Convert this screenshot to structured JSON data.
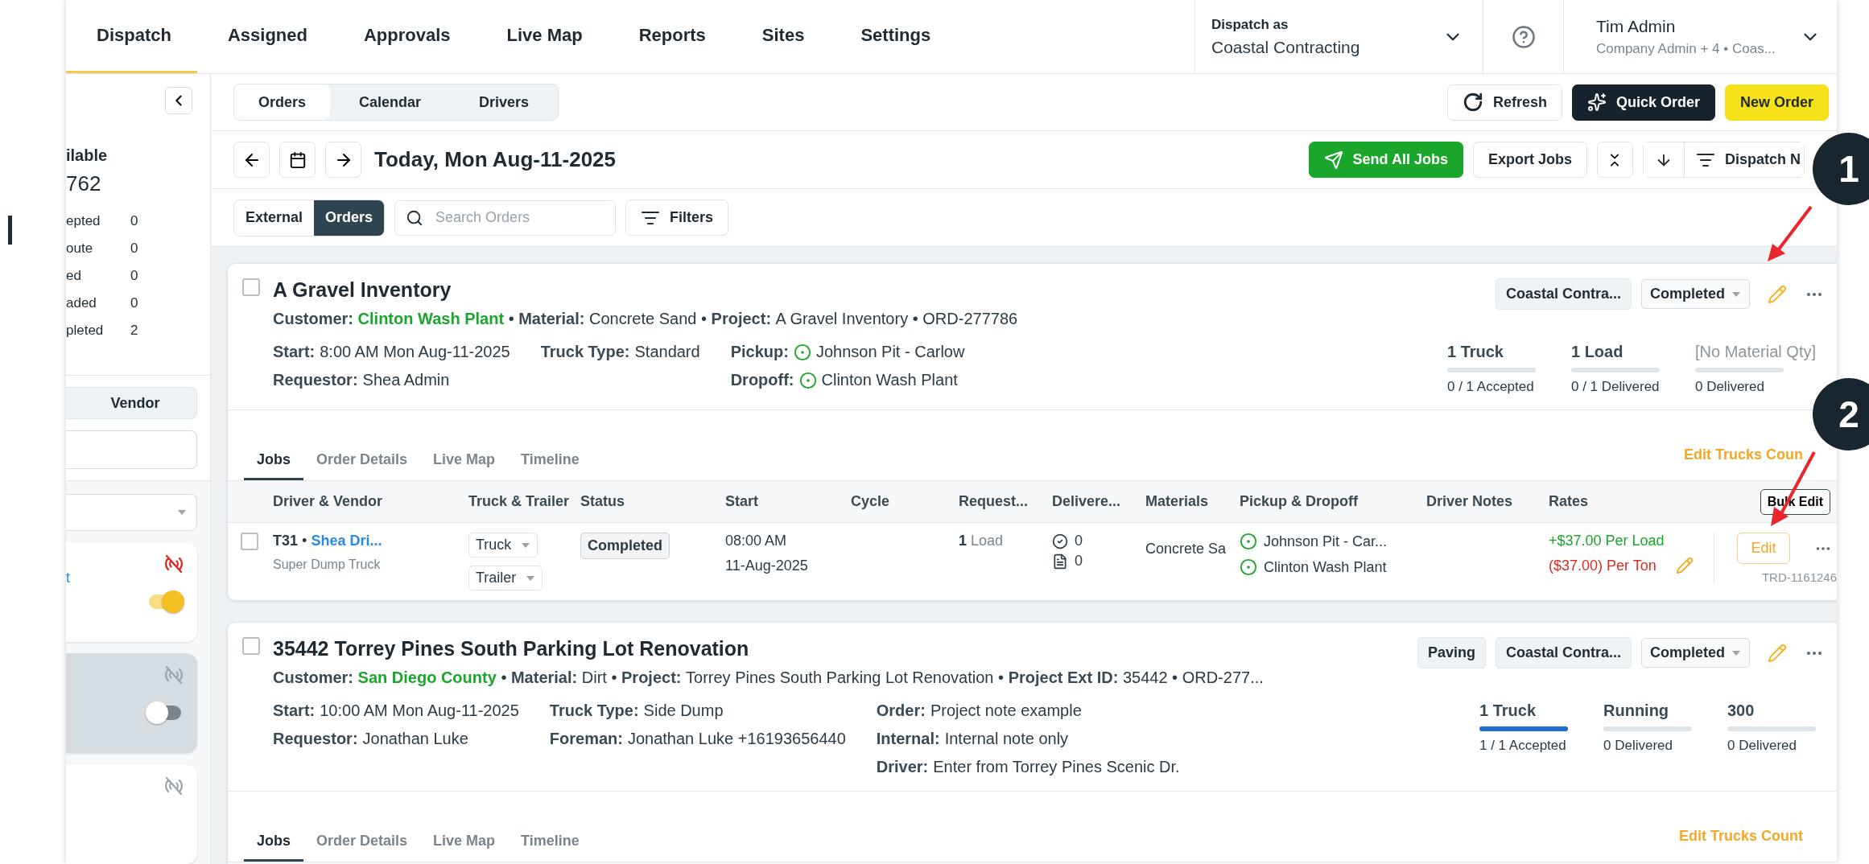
{
  "nav": {
    "tabs": [
      {
        "label": "Dispatch",
        "selected": true
      },
      {
        "label": "Assigned",
        "selected": false
      },
      {
        "label": "Approvals",
        "selected": false
      },
      {
        "label": "Live Map",
        "selected": false
      },
      {
        "label": "Reports",
        "selected": false
      },
      {
        "label": "Sites",
        "selected": false
      },
      {
        "label": "Settings",
        "selected": false
      }
    ],
    "dispatch_as": {
      "label": "Dispatch as",
      "value": "Coastal Contracting"
    },
    "user": {
      "name": "Tim Admin",
      "role": "Company Admin + 4 • Coas..."
    }
  },
  "sidebar": {
    "stats_title": "ilable",
    "stats_total": "762",
    "stats": [
      {
        "label": "epted",
        "value": "0"
      },
      {
        "label": "oute",
        "value": "0"
      },
      {
        "label": "ed",
        "value": "0"
      },
      {
        "label": "aded",
        "value": "0"
      },
      {
        "label": "pleted",
        "value": "2"
      }
    ],
    "segment": "Vendor",
    "drivers": [
      {
        "name": "t",
        "signal_lost": true,
        "on": true,
        "selected": false
      },
      {
        "signal_lost": false,
        "on": false,
        "selected": true
      },
      {
        "signal_lost": false,
        "selected": false
      }
    ]
  },
  "view_tabs": [
    {
      "label": "Orders",
      "selected": true
    },
    {
      "label": "Calendar",
      "selected": false
    },
    {
      "label": "Drivers",
      "selected": false
    }
  ],
  "actions": [
    {
      "kind": "refresh",
      "label": "Refresh"
    },
    {
      "kind": "quick",
      "label": "Quick Order"
    },
    {
      "kind": "new",
      "label": "New Order"
    }
  ],
  "date": "Today, Mon Aug-11-2025",
  "toolbar": {
    "send": "Send All Jobs",
    "export": "Export Jobs",
    "sort": "Dispatch N"
  },
  "source_tabs": [
    {
      "label": "External",
      "selected": false
    },
    {
      "label": "Orders",
      "selected": true
    }
  ],
  "search": {
    "placeholder": "Search Orders"
  },
  "filters": "Filters",
  "orders": [
    {
      "title": "A Gravel Inventory",
      "checked": false,
      "separator": "•",
      "tags": [
        "Coastal Contra..."
      ],
      "status": "Completed",
      "meta": [
        {
          "label": "Customer:",
          "value": "Clinton Wash Plant",
          "kind": "link"
        },
        {
          "label": "Material:",
          "value": "Concrete Sand"
        },
        {
          "label": "Project:",
          "value": "A Gravel Inventory"
        },
        {
          "value": "ORD-277786"
        }
      ],
      "details": [
        [
          {
            "label": "Start:",
            "value": "8:00 AM Mon Aug-11-2025"
          },
          {
            "label": "Requestor:",
            "value": "Shea Admin"
          }
        ],
        [
          {
            "label": "Truck Type:",
            "value": "Standard"
          }
        ],
        [
          {
            "label": "Pickup:",
            "value": "Johnson Pit - Carlow",
            "kind": "location"
          },
          {
            "label": "Dropoff:",
            "value": "Clinton Wash Plant",
            "kind": "location"
          }
        ]
      ],
      "progress": [
        {
          "title": "1 Truck",
          "level": 0,
          "caption": "0 / 1 Accepted"
        },
        {
          "title": "1 Load",
          "level": 0,
          "caption": "0 / 1 Delivered"
        },
        {
          "title": "[No Material Qty]",
          "muted": true,
          "level": 0,
          "caption": "0 Delivered"
        }
      ],
      "tabs": [
        {
          "label": "Jobs",
          "selected": true
        },
        {
          "label": "Order Details",
          "selected": false
        },
        {
          "label": "Live Map",
          "selected": false
        },
        {
          "label": "Timeline",
          "selected": false
        }
      ],
      "edit_trucks": "Edit Trucks Coun",
      "jobs": {
        "columns": [
          "Driver & Vendor",
          "Truck & Trailer",
          "Status",
          "Start",
          "Cycle",
          "Request...",
          "Delivere...",
          "Materials",
          "Pickup & Dropoff",
          "Driver Notes",
          "Rates"
        ],
        "bulk_edit": "Bulk Edit",
        "rows": [
          {
            "checked": false,
            "truck": "T31",
            "separator": "•",
            "driver": "Shea Dri...",
            "vehicle": "Super Dump Truck",
            "truck_select": "Truck",
            "trailer_select": "Trailer",
            "status": "Completed",
            "start_time": "08:00 AM",
            "start_date": "11-Aug-2025",
            "requested_count": "1",
            "requested_unit": "Load",
            "delivered_done": "0",
            "delivered_tickets": "0",
            "material": "Concrete Sa",
            "pickup": "Johnson Pit - Car...",
            "dropoff": "Clinton Wash Plant",
            "rate_pay": "+$37.00 Per Load",
            "rate_charge": "($37.00) Per Ton",
            "edit": "Edit",
            "job_id": "TRD-1161246"
          }
        ]
      }
    },
    {
      "title": "35442 Torrey Pines South Parking Lot Renovation",
      "checked": false,
      "separator": "•",
      "tags": [
        "Paving",
        "Coastal Contra..."
      ],
      "status": "Completed",
      "meta": [
        {
          "label": "Customer:",
          "value": "San Diego County",
          "kind": "link"
        },
        {
          "label": "Material:",
          "value": "Dirt"
        },
        {
          "label": "Project:",
          "value": "Torrey Pines South Parking Lot Renovation"
        },
        {
          "label": "Project Ext ID:",
          "value": "35442"
        },
        {
          "value": "ORD-277..."
        }
      ],
      "details": [
        [
          {
            "label": "Start:",
            "value": "10:00 AM Mon Aug-11-2025"
          },
          {
            "label": "Requestor:",
            "value": "Jonathan Luke"
          }
        ],
        [
          {
            "label": "Truck Type:",
            "value": "Side Dump"
          },
          {
            "label": "Foreman:",
            "value": "Jonathan Luke +16193656440"
          }
        ],
        [
          {
            "label": "Order:",
            "value": "Project note example"
          },
          {
            "label": "Internal:",
            "value": "Internal note only"
          },
          {
            "label": "Driver:",
            "value": "Enter from Torrey Pines Scenic Dr."
          }
        ]
      ],
      "progress": [
        {
          "title": "1 Truck",
          "level": 1,
          "caption": "1 / 1 Accepted"
        },
        {
          "title": "Running",
          "level": 0,
          "caption": "0 Delivered"
        },
        {
          "title": "300",
          "level": 0,
          "caption": "0 Delivered"
        }
      ],
      "tabs": [
        {
          "label": "Jobs",
          "selected": true
        },
        {
          "label": "Order Details",
          "selected": false
        },
        {
          "label": "Live Map",
          "selected": false
        },
        {
          "label": "Timeline",
          "selected": false
        }
      ],
      "edit_trucks": "Edit Trucks Count"
    }
  ],
  "annotations": [
    {
      "label": "1"
    },
    {
      "label": "2"
    }
  ]
}
